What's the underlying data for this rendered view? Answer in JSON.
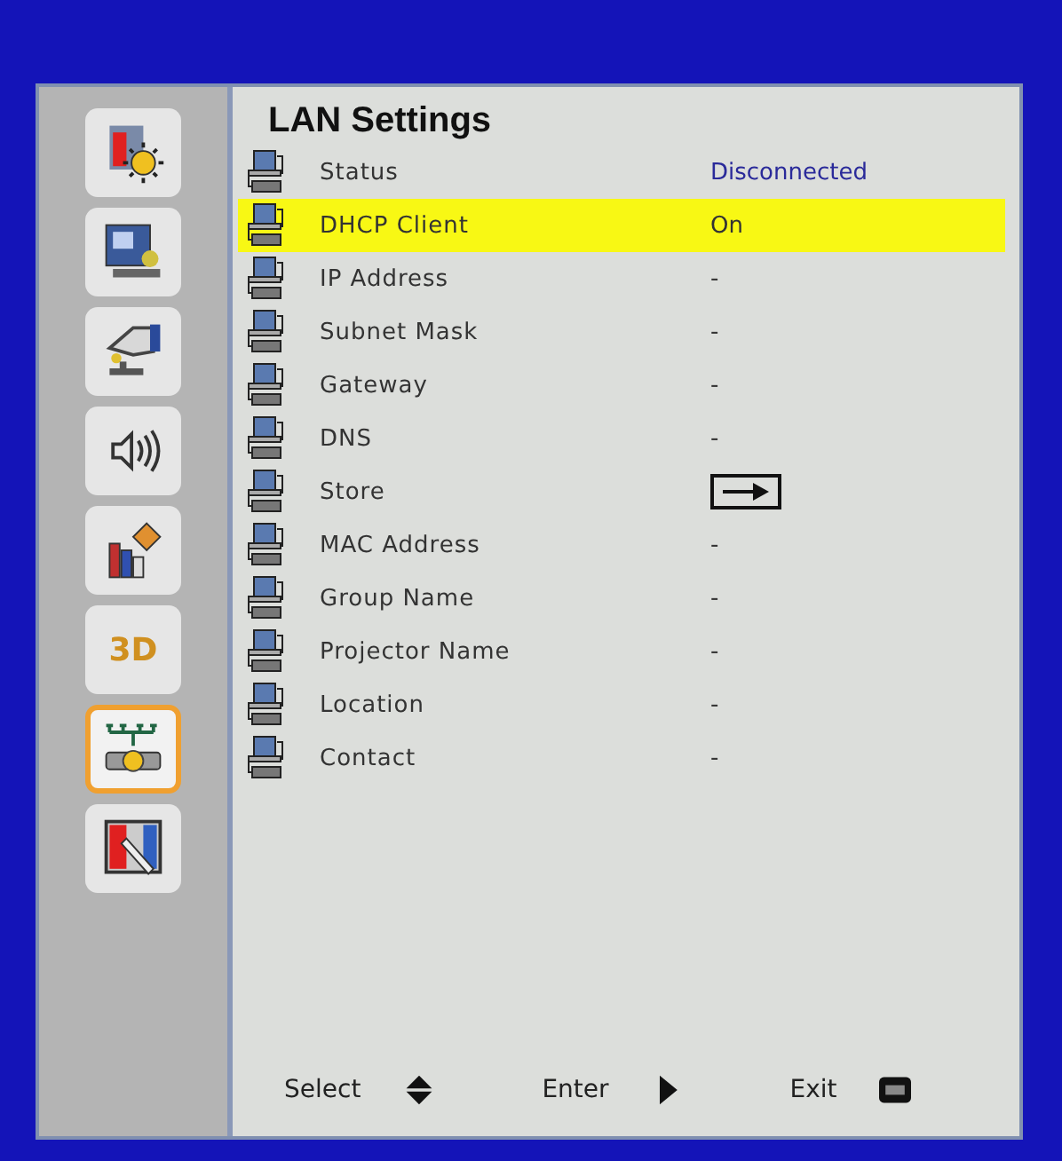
{
  "sidebar": {
    "items": [
      {
        "kind": "image",
        "selected": false
      },
      {
        "kind": "display",
        "selected": false
      },
      {
        "kind": "setup",
        "selected": false
      },
      {
        "kind": "audio",
        "selected": false
      },
      {
        "kind": "options",
        "selected": false
      },
      {
        "kind": "text",
        "label": "3D",
        "selected": false
      },
      {
        "kind": "network",
        "selected": true
      },
      {
        "kind": "pen",
        "selected": false
      }
    ]
  },
  "panel": {
    "title": "LAN Settings",
    "rows": [
      {
        "label": "Status",
        "kind": "status",
        "value": "Disconnected",
        "selected": false
      },
      {
        "label": "DHCP Client",
        "kind": "text",
        "value": "On",
        "selected": true
      },
      {
        "label": "IP Address",
        "kind": "text",
        "value": "-",
        "selected": false
      },
      {
        "label": "Subnet Mask",
        "kind": "text",
        "value": "-",
        "selected": false
      },
      {
        "label": "Gateway",
        "kind": "text",
        "value": "-",
        "selected": false
      },
      {
        "label": "DNS",
        "kind": "text",
        "value": "-",
        "selected": false
      },
      {
        "label": "Store",
        "kind": "action",
        "selected": false
      },
      {
        "label": "MAC Address",
        "kind": "text",
        "value": "-",
        "selected": false
      },
      {
        "label": "Group Name",
        "kind": "text",
        "value": "-",
        "selected": false
      },
      {
        "label": "Projector Name",
        "kind": "text",
        "value": "-",
        "selected": false
      },
      {
        "label": "Location",
        "kind": "text",
        "value": "-",
        "selected": false
      },
      {
        "label": "Contact",
        "kind": "text",
        "value": "-",
        "selected": false
      }
    ]
  },
  "footer": [
    {
      "label": "Select",
      "kind": "updown"
    },
    {
      "label": "Enter",
      "kind": "right"
    },
    {
      "label": "Exit",
      "kind": "menu"
    }
  ]
}
